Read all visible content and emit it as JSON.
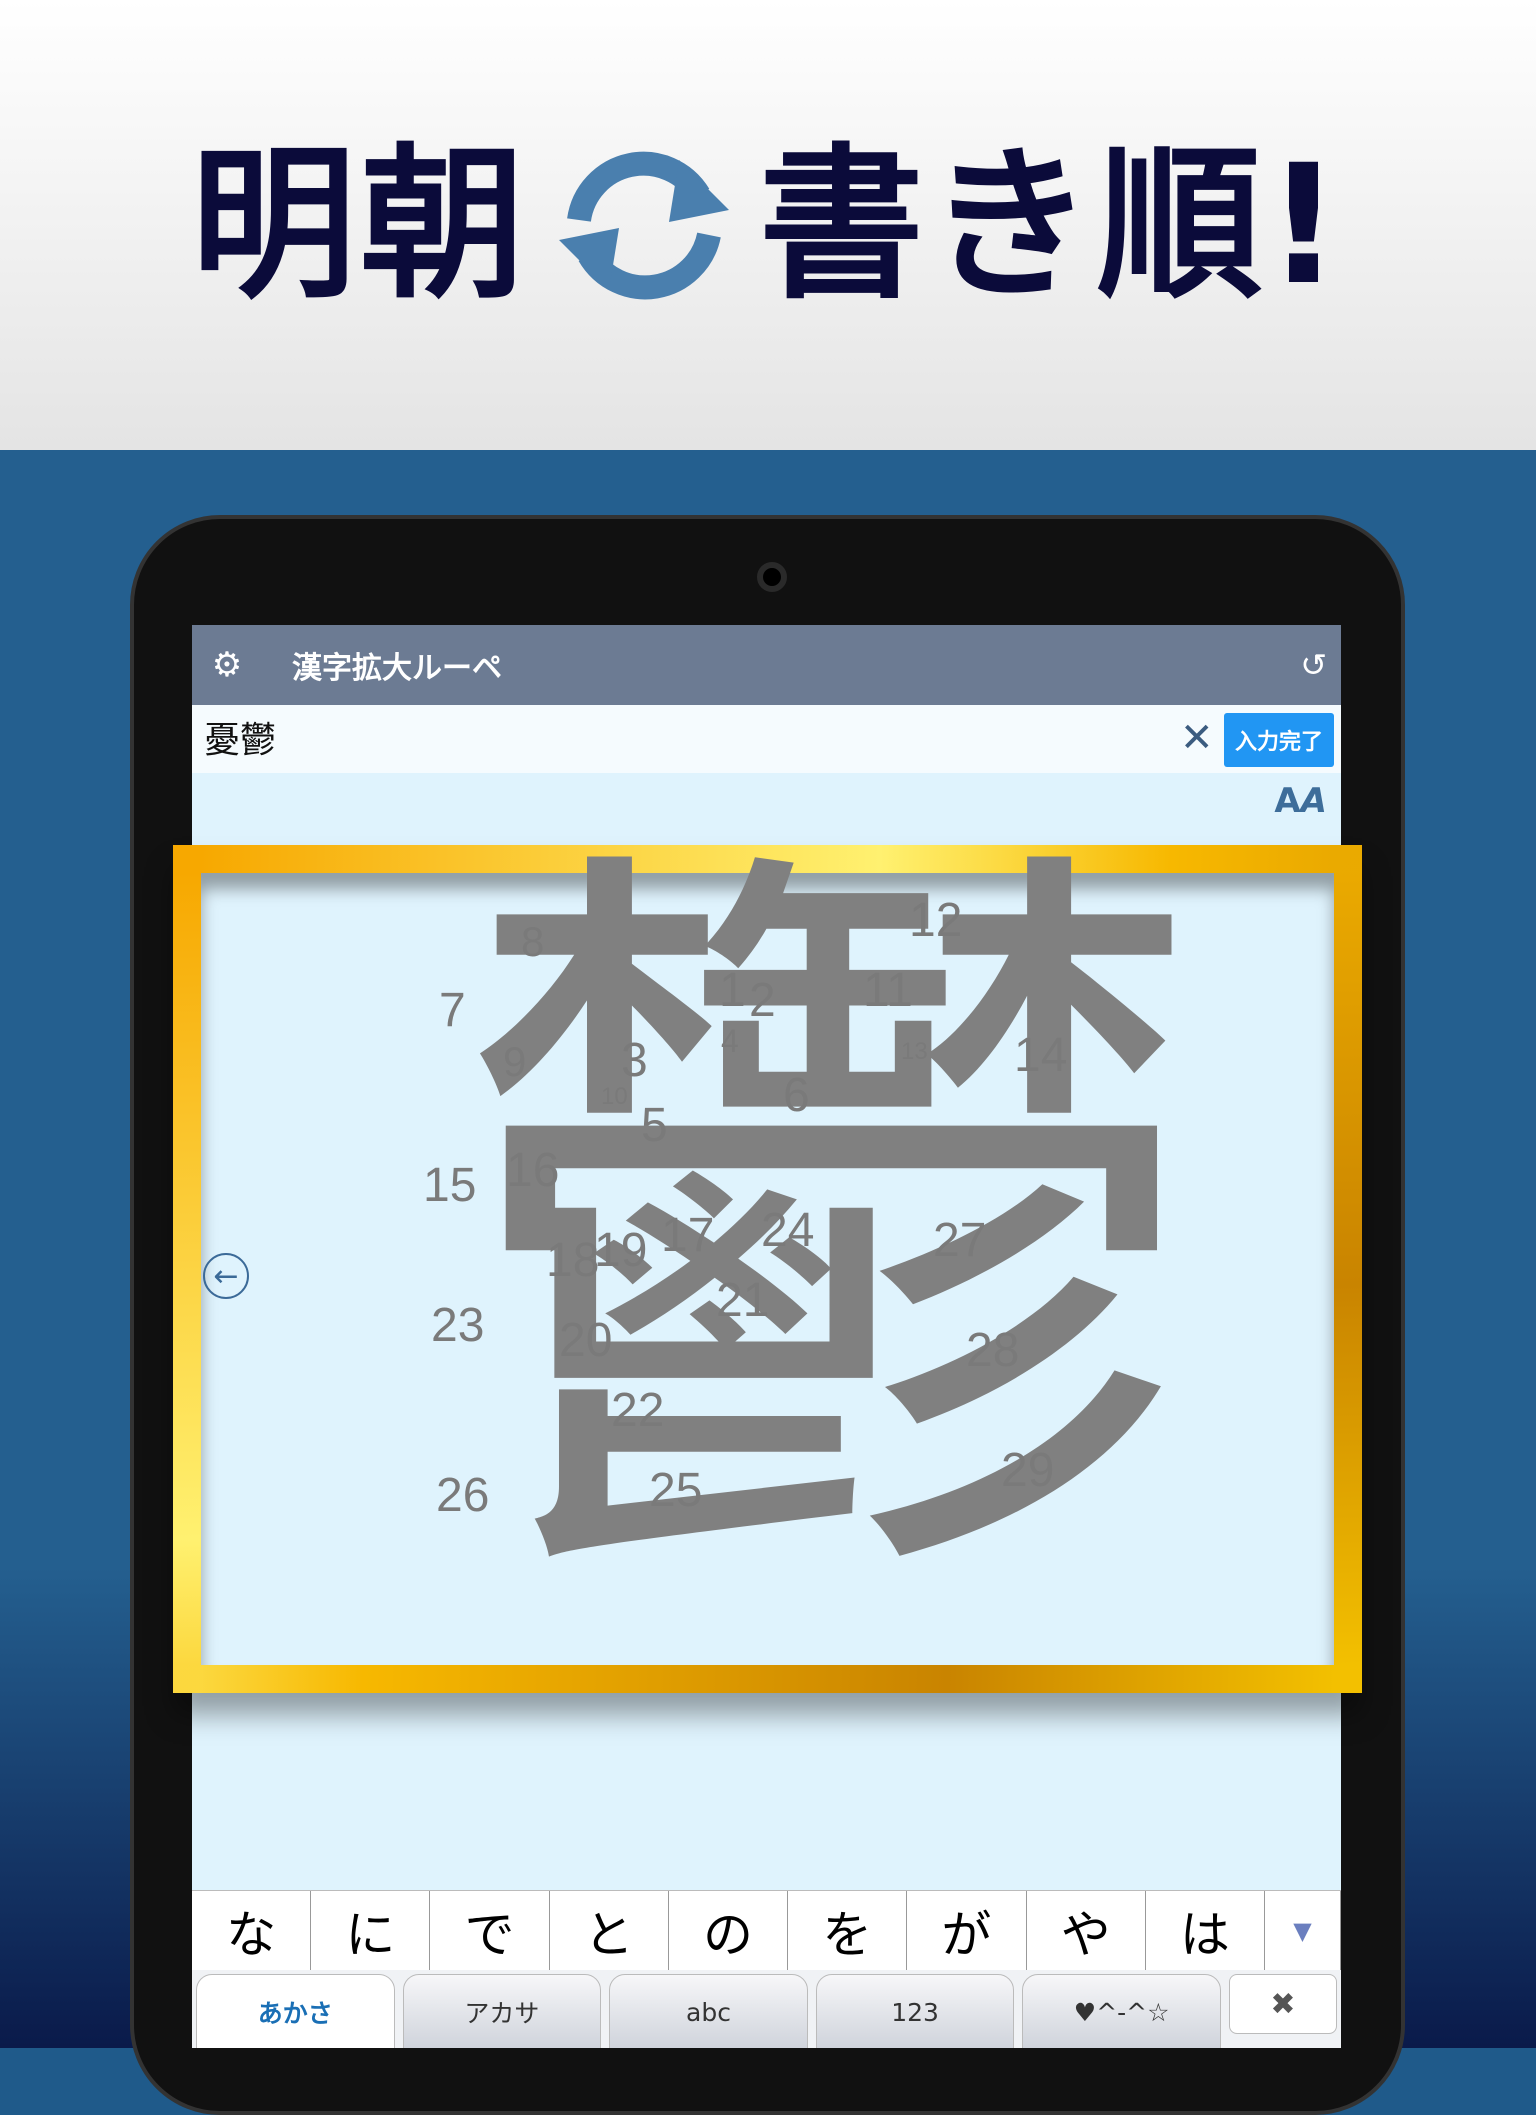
{
  "hero": {
    "left": "明朝",
    "right": "書き順!",
    "icon": "refresh-cycle-icon",
    "color": "#0b0b3a"
  },
  "app": {
    "title": "漢字拡大ルーペ",
    "settings_icon": "gear-icon",
    "history_icon": "history-icon",
    "input_value": "憂鬱",
    "clear_icon": "close-icon",
    "done_label": "入力完了",
    "font_toggle_icon": "font-style-icon"
  },
  "display": {
    "kanji": "鬱",
    "back_icon": "arrow-left-circle-icon",
    "stroke_numbers": [
      "1",
      "2",
      "3",
      "4",
      "5",
      "6",
      "7",
      "8",
      "9",
      "10",
      "11",
      "12",
      "13",
      "14",
      "15",
      "16",
      "17",
      "18",
      "19",
      "20",
      "21",
      "22",
      "23",
      "24",
      "25",
      "26",
      "27",
      "28",
      "29"
    ]
  },
  "keyboard": {
    "suggestions": [
      "な",
      "に",
      "で",
      "と",
      "の",
      "を",
      "が",
      "や",
      "は"
    ],
    "expand_icon": "triangle-down-icon",
    "tabs": [
      "あかさ",
      "アカサ",
      "abc",
      "123",
      "♥^-^☆"
    ],
    "delete_icon": "close-x-icon",
    "delete_label": "✖"
  }
}
